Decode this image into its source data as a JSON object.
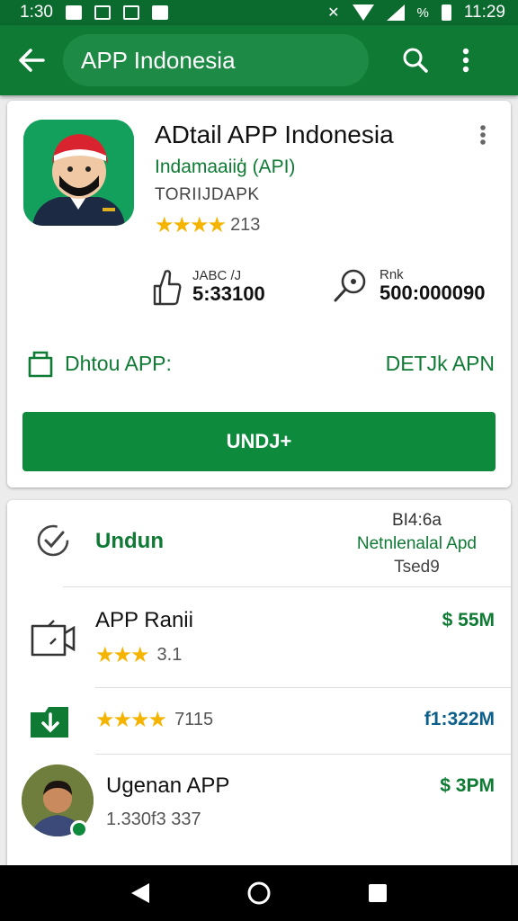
{
  "status_bar": {
    "time_left": "1:30",
    "battery_percent": "%",
    "time_right": "11:29"
  },
  "app_bar": {
    "search_text": "APP Indonesia"
  },
  "app": {
    "title": "ADtail APP Indonesia",
    "developer": "Indamaaiiģ (API)",
    "category": "TORIIJDAPK",
    "rating_stars": 4,
    "rating_count": "213",
    "stat1": {
      "label": "JABC     /J",
      "value": "5:33100"
    },
    "stat2": {
      "label": "Rnk",
      "value": "500:000090"
    },
    "detail_left": "Dhtou APP:",
    "detail_right": "DETJk APN",
    "install_label": "UNDJ+"
  },
  "list": {
    "header_title": "Undun",
    "header_right_line1": "BI4:6a",
    "header_right_line2": "Netnlenalal Apd",
    "header_right_line3": "Tsed9",
    "items": [
      {
        "name": "APP Ranii",
        "rating_text": "3.1",
        "stars": 3,
        "size": "$ 55M"
      },
      {
        "name": "",
        "rating_text": "7115",
        "stars": 4,
        "size": "f1:322M"
      },
      {
        "name": "Ugenan APP",
        "rating_text": "1.330f3 337",
        "stars": 0,
        "size": "$ 3PM"
      }
    ]
  },
  "colors": {
    "primary": "#0e7a34",
    "primary_dark": "#0b6b2e",
    "star": "#f5b400"
  }
}
